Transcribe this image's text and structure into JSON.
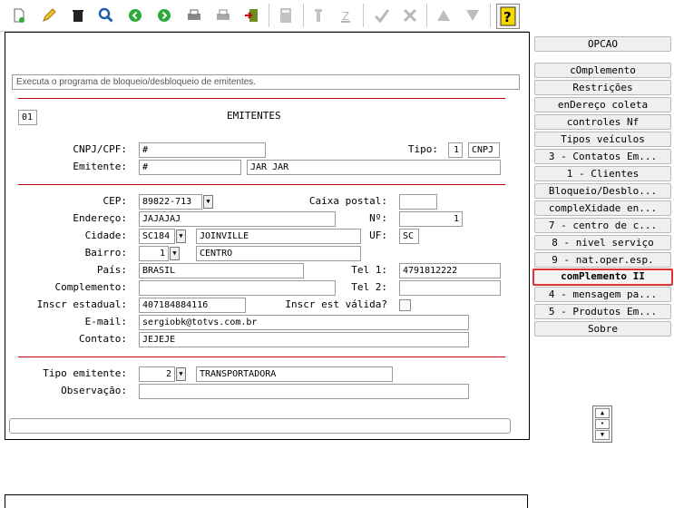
{
  "toolbar": {
    "icons": [
      "new-document-icon",
      "edit-icon",
      "delete-icon",
      "search-icon",
      "previous-icon",
      "next-icon",
      "print-icon",
      "print-preview-icon",
      "export-icon",
      "calculator-icon",
      "tools-icon",
      "sort-icon",
      "check-icon",
      "cancel-icon",
      "up-icon",
      "down-icon",
      "help-icon"
    ]
  },
  "message": "Executa o programa de bloqueio/desbloqueio de emitentes.",
  "header": {
    "code": "01",
    "title": "EMITENTES"
  },
  "form": {
    "cnpj_label": "CNPJ/CPF:",
    "cnpj_value": "#",
    "tipo_label": "Tipo:",
    "tipo_code": "1",
    "tipo_desc": "CNPJ",
    "emitente_label": "Emitente:",
    "emitente_code": "#",
    "emitente_name": "JAR JAR",
    "cep_label": "CEP:",
    "cep_value": "89822-713",
    "caixa_label": "Caixa postal:",
    "caixa_value": "",
    "endereco_label": "Endereço:",
    "endereco_value": "JAJAJAJ",
    "numero_label": "Nº:",
    "numero_value": "1",
    "cidade_label": "Cidade:",
    "cidade_code": "SC184",
    "cidade_name": "JOINVILLE",
    "uf_label": "UF:",
    "uf_value": "SC",
    "bairro_label": "Bairro:",
    "bairro_code": "1",
    "bairro_name": "CENTRO",
    "pais_label": "País:",
    "pais_value": "BRASIL",
    "tel1_label": "Tel 1:",
    "tel1_value": "4791812222",
    "complemento_label": "Complemento:",
    "complemento_value": "",
    "tel2_label": "Tel 2:",
    "tel2_value": "",
    "ie_label": "Inscr estadual:",
    "ie_value": "407184884116",
    "ie_valid_label": "Inscr est válida?",
    "email_label": "E-mail:",
    "email_value": "sergiobk@totvs.com.br",
    "contato_label": "Contato:",
    "contato_value": "JEJEJE",
    "tipo_emitente_label": "Tipo emitente:",
    "tipo_emitente_code": "2",
    "tipo_emitente_desc": "TRANSPORTADORA",
    "observacao_label": "Observação:",
    "observacao_value": ""
  },
  "side_menu": {
    "header": "OPCAO",
    "items": [
      "cOmplemento",
      "Restrições",
      "enDereço coleta",
      "controles Nf",
      "Tipos veículos",
      "3 - Contatos Em...",
      "1 - Clientes",
      "Bloqueio/Desblo...",
      "compleXidade en...",
      "7 - centro de c...",
      "8 - nivel serviço",
      "9 - nat.oper.esp.",
      "comPlemento II",
      "4 - mensagem pa...",
      "5 - Produtos Em...",
      "Sobre"
    ],
    "selected_index": 12
  },
  "colors": {
    "accent_line": "#c00000",
    "selected_border": "#d33333"
  }
}
